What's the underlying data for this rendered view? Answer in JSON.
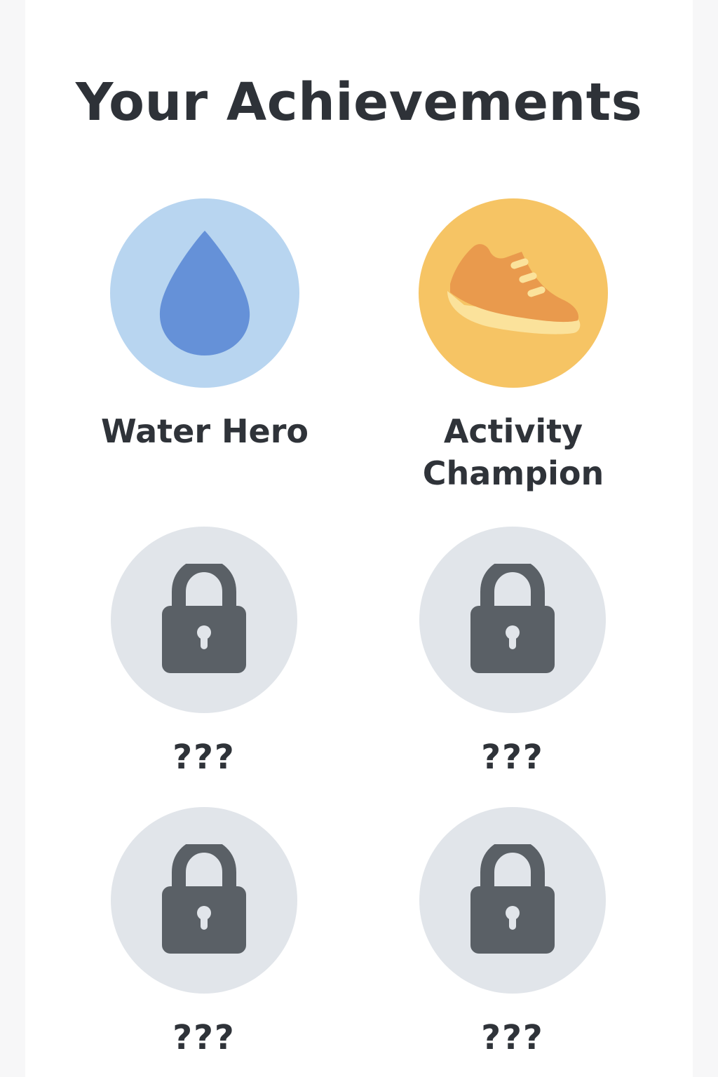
{
  "header": {
    "title": "Your Achievements"
  },
  "colors": {
    "water_bg": "#b8d5f0",
    "water_drop": "#6591d8",
    "activity_bg": "#f6c464",
    "shoe_body": "#e99a4d",
    "shoe_sole": "#fbe29b",
    "locked_bg": "#e1e5ea",
    "lock": "#5a6066",
    "text": "#2f3339"
  },
  "achievements": [
    {
      "label": "Water Hero",
      "icon": "water-drop-icon",
      "unlocked": true
    },
    {
      "label": "Activity\nChampion",
      "icon": "sneaker-icon",
      "unlocked": true
    },
    {
      "label": "???",
      "icon": "lock-icon",
      "unlocked": false
    },
    {
      "label": "???",
      "icon": "lock-icon",
      "unlocked": false
    },
    {
      "label": "???",
      "icon": "lock-icon",
      "unlocked": false
    },
    {
      "label": "???",
      "icon": "lock-icon",
      "unlocked": false
    }
  ]
}
